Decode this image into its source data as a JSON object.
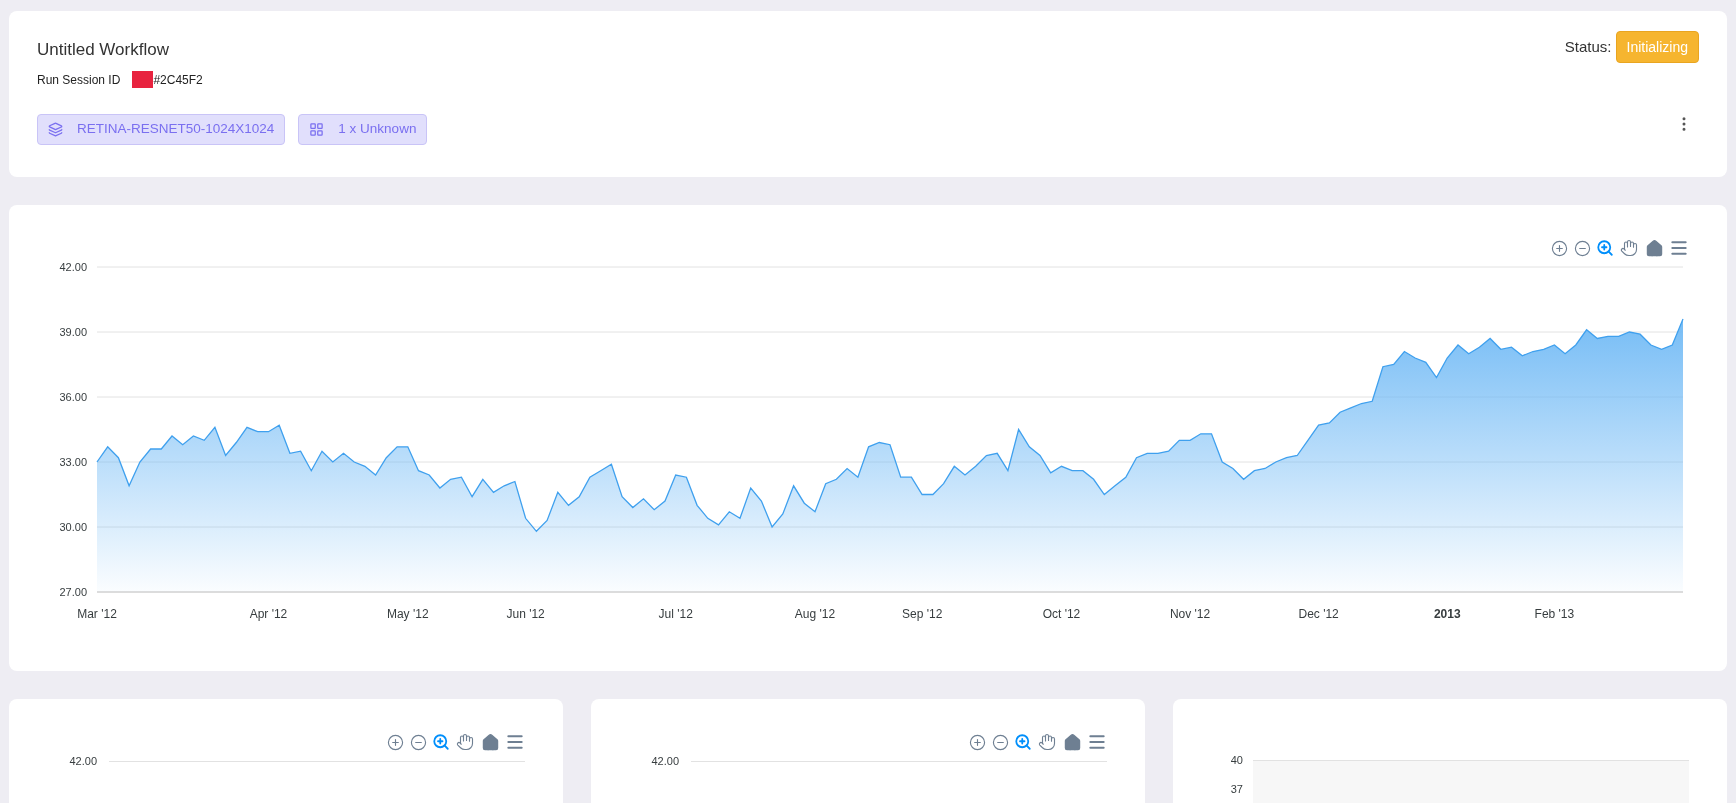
{
  "header": {
    "title": "Untitled Workflow",
    "session_label": "Run Session ID",
    "session_id": "#2C45F2",
    "status_label": "Status:",
    "status": "Initializing",
    "tags": [
      {
        "kind": "model",
        "label": "RETINA-RESNET50-1024X1024"
      },
      {
        "kind": "compute",
        "label": "1 x Unknown"
      }
    ]
  },
  "main_chart": {
    "chart_data": {
      "type": "area",
      "grid": true,
      "ylim": [
        27,
        42
      ],
      "categories": [
        "Mar '12",
        null,
        null,
        null,
        null,
        null,
        null,
        null,
        null,
        null,
        null,
        null,
        null,
        null,
        null,
        null,
        "Apr '12",
        null,
        null,
        null,
        null,
        null,
        null,
        null,
        null,
        null,
        null,
        null,
        null,
        "May '12",
        null,
        null,
        null,
        null,
        null,
        null,
        null,
        null,
        null,
        null,
        "Jun '12",
        null,
        null,
        null,
        null,
        null,
        null,
        null,
        null,
        null,
        null,
        null,
        null,
        null,
        "Jul '12",
        null,
        null,
        null,
        null,
        null,
        null,
        null,
        null,
        null,
        null,
        null,
        null,
        "Aug '12",
        null,
        null,
        null,
        null,
        null,
        null,
        null,
        null,
        null,
        "Sep '12",
        null,
        null,
        null,
        null,
        null,
        null,
        null,
        null,
        null,
        null,
        null,
        null,
        "Oct '12",
        null,
        null,
        null,
        null,
        null,
        null,
        null,
        null,
        null,
        null,
        null,
        "Nov '12",
        null,
        null,
        null,
        null,
        null,
        null,
        null,
        null,
        null,
        null,
        null,
        "Dec '12",
        null,
        null,
        null,
        null,
        null,
        null,
        null,
        null,
        null,
        null,
        null,
        "**2013**",
        null,
        null,
        null,
        null,
        null,
        null,
        null,
        null,
        null,
        "Feb '13",
        null,
        null,
        null,
        null,
        null,
        null,
        null,
        null,
        null,
        null,
        null,
        null
      ],
      "yticks": [
        {
          "value": 27,
          "label": "27.00"
        },
        {
          "value": 30,
          "label": "30.00"
        },
        {
          "value": 33,
          "label": "33.00"
        },
        {
          "value": 36,
          "label": "36.00"
        },
        {
          "value": 39,
          "label": "39.00"
        },
        {
          "value": 42,
          "label": "42.00"
        }
      ],
      "series": [
        {
          "color": "#3fa0ee",
          "values": [
            33.0,
            33.7,
            33.2,
            31.9,
            33.0,
            33.6,
            33.6,
            34.2,
            33.8,
            34.2,
            34.0,
            34.6,
            33.3,
            33.9,
            34.6,
            34.4,
            34.4,
            34.7,
            33.4,
            33.5,
            32.6,
            33.5,
            33.0,
            33.4,
            33.0,
            32.8,
            32.4,
            33.2,
            33.7,
            33.7,
            32.6,
            32.4,
            31.8,
            32.2,
            32.3,
            31.4,
            32.2,
            31.6,
            31.9,
            32.1,
            30.4,
            29.8,
            30.3,
            31.6,
            31.0,
            31.4,
            32.3,
            32.6,
            32.9,
            31.4,
            30.9,
            31.3,
            30.8,
            31.2,
            32.4,
            32.3,
            31.0,
            30.4,
            30.1,
            30.7,
            30.4,
            31.8,
            31.2,
            30.0,
            30.6,
            31.9,
            31.1,
            30.7,
            32.0,
            32.2,
            32.7,
            32.3,
            33.7,
            33.9,
            33.8,
            32.3,
            32.3,
            31.5,
            31.5,
            32.0,
            32.8,
            32.4,
            32.8,
            33.3,
            33.4,
            32.6,
            34.5,
            33.7,
            33.3,
            32.5,
            32.8,
            32.6,
            32.6,
            32.2,
            31.5,
            31.9,
            32.3,
            33.2,
            33.4,
            33.4,
            33.5,
            34.0,
            34.0,
            34.3,
            34.3,
            33.0,
            32.7,
            32.2,
            32.6,
            32.7,
            33.0,
            33.2,
            33.3,
            34.0,
            34.7,
            34.8,
            35.3,
            35.5,
            35.7,
            35.8,
            37.4,
            37.5,
            38.1,
            37.8,
            37.6,
            36.9,
            37.8,
            38.4,
            38.0,
            38.3,
            38.7,
            38.2,
            38.3,
            37.9,
            38.1,
            38.2,
            38.4,
            38.0,
            38.4,
            39.1,
            38.7,
            38.8,
            38.8,
            39.0,
            38.9,
            38.4,
            38.2,
            38.4,
            39.6
          ]
        }
      ]
    }
  },
  "small_charts": [
    {
      "kind": "line",
      "y_labels": [
        "42.00"
      ]
    },
    {
      "kind": "line",
      "y_labels": [
        "42.00"
      ]
    },
    {
      "kind": "band",
      "y_labels": [
        "40",
        "37"
      ]
    }
  ]
}
